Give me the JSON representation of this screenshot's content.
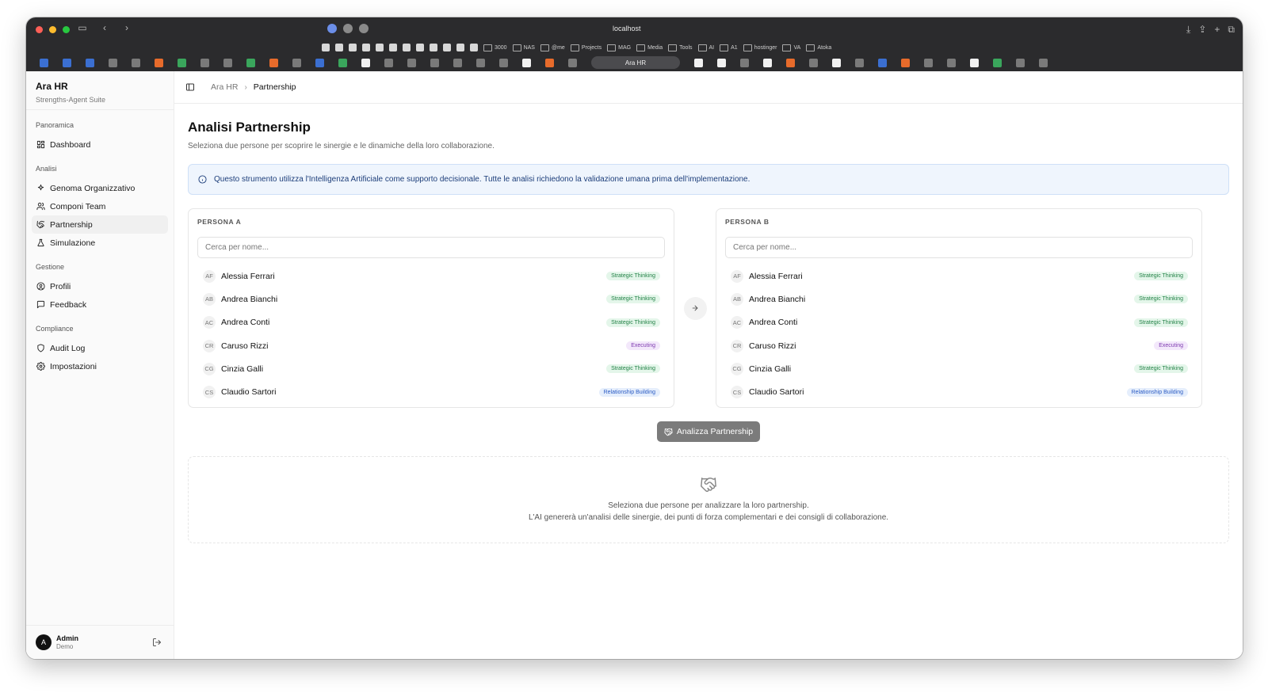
{
  "browser": {
    "url": "localhost",
    "bookmarks": [
      "3000",
      "NAS",
      "@me",
      "Projects",
      "MAG",
      "Media",
      "Tools",
      "AI",
      "A1",
      "hostinger",
      "VA",
      "Atoka"
    ],
    "active_tab": "Ara HR"
  },
  "sidebar": {
    "brand_title": "Ara HR",
    "brand_sub": "Strengths-Agent Suite",
    "groups": [
      {
        "label": "Panoramica",
        "items": [
          {
            "label": "Dashboard",
            "icon": "dashboard-icon"
          }
        ]
      },
      {
        "label": "Analisi",
        "items": [
          {
            "label": "Genoma Organizzativo",
            "icon": "sparkle-icon"
          },
          {
            "label": "Componi Team",
            "icon": "users-icon"
          },
          {
            "label": "Partnership",
            "icon": "handshake-icon",
            "active": true
          },
          {
            "label": "Simulazione",
            "icon": "flask-icon"
          }
        ]
      },
      {
        "label": "Gestione",
        "items": [
          {
            "label": "Profili",
            "icon": "user-circle-icon"
          },
          {
            "label": "Feedback",
            "icon": "message-icon"
          }
        ]
      },
      {
        "label": "Compliance",
        "items": [
          {
            "label": "Audit Log",
            "icon": "shield-icon"
          },
          {
            "label": "Impostazioni",
            "icon": "gear-icon"
          }
        ]
      }
    ],
    "user": {
      "initial": "A",
      "name": "Admin",
      "role": "Demo"
    }
  },
  "breadcrumb": {
    "root": "Ara HR",
    "current": "Partnership"
  },
  "page": {
    "title": "Analisi Partnership",
    "subtitle": "Seleziona due persone per scoprire le sinergie e le dinamiche della loro collaborazione.",
    "notice": "Questo strumento utilizza l'Intelligenza Artificiale come supporto decisionale. Tutte le analisi richiedono la validazione umana prima dell'implementazione."
  },
  "persona_a": {
    "label": "PERSONA A",
    "placeholder": "Cerca per nome..."
  },
  "persona_b": {
    "label": "PERSONA B",
    "placeholder": "Cerca per nome..."
  },
  "people": [
    {
      "initials": "AF",
      "name": "Alessia Ferrari",
      "domain": "Strategic Thinking",
      "kind": "strategic"
    },
    {
      "initials": "AB",
      "name": "Andrea Bianchi",
      "domain": "Strategic Thinking",
      "kind": "strategic"
    },
    {
      "initials": "AC",
      "name": "Andrea Conti",
      "domain": "Strategic Thinking",
      "kind": "strategic"
    },
    {
      "initials": "CR",
      "name": "Caruso Rizzi",
      "domain": "Executing",
      "kind": "executing"
    },
    {
      "initials": "CG",
      "name": "Cinzia Galli",
      "domain": "Strategic Thinking",
      "kind": "strategic"
    },
    {
      "initials": "CS",
      "name": "Claudio Sartori",
      "domain": "Relationship Building",
      "kind": "relationship"
    }
  ],
  "analyze_button": "Analizza Partnership",
  "empty_state": {
    "line1": "Seleziona due persone per analizzare la loro partnership.",
    "line2": "L'AI genererà un'analisi delle sinergie, dei punti di forza complementari e dei consigli di collaborazione."
  },
  "colors": {
    "accent": "#111111",
    "notice_bg": "#eff5fd",
    "strategic": "#238247",
    "executing": "#7e3bb0",
    "relationship": "#2a5bc4"
  }
}
